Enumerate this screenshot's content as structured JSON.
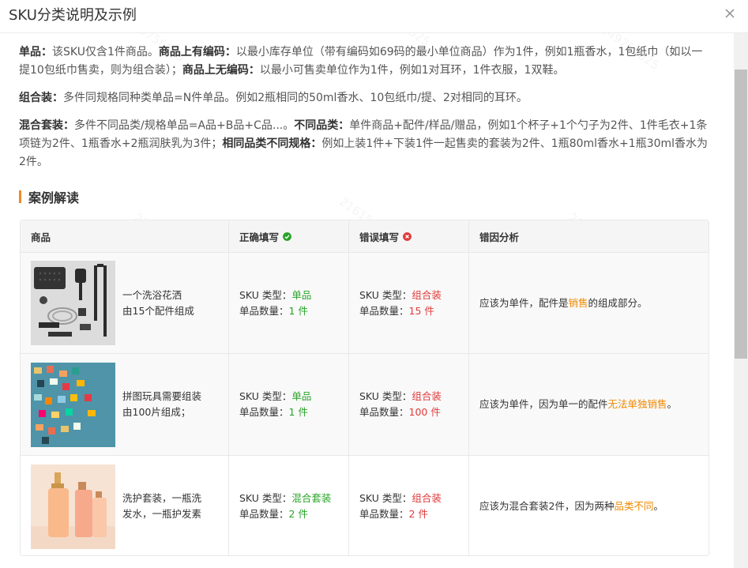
{
  "dialog": {
    "title": "SKU分类说明及示例",
    "close_icon": "close-icon"
  },
  "definitions": {
    "single_label": "单品：",
    "single_text": "该SKU仅含1件商品。",
    "with_code_label": "商品上有编码：",
    "with_code_text": "以最小库存单位（带有编码如69码的最小单位商品）作为1件，例如1瓶香水，1包纸巾（如以一提10包纸巾售卖，则为组合装）；",
    "no_code_label": "商品上无编码：",
    "no_code_text": "以最小可售卖单位作为1件，例如1对耳环，1件衣服，1双鞋。",
    "combo_label": "组合装：",
    "combo_text": "多件同规格同种类单品=N件单品。例如2瓶相同的50ml香水、10包纸巾/提、2对相同的耳环。",
    "mixed_label": "混合套装：",
    "mixed_text": "多件不同品类/规格单品=A品+B品+C品...。",
    "diff_cat_label": "不同品类：",
    "diff_cat_text": "单件商品+配件/样品/赠品，例如1个杯子+1个勺子为2件、1件毛衣+1条项链为2件、1瓶香水+2瓶润肤乳为3件；",
    "same_cat_label": "相同品类不同规格：",
    "same_cat_text": "例如上装1件+下装1件一起售卖的套装为2件、1瓶80ml香水+1瓶30ml香水为2件。"
  },
  "section_title": "案例解读",
  "table": {
    "headers": [
      "商品",
      "正确填写",
      "错误填写",
      "错因分析"
    ],
    "type_label": "SKU 类型：",
    "count_label": "单品数量：",
    "rows": [
      {
        "product_line1": "一个洗浴花洒",
        "product_line2": "由15个配件组成",
        "correct_type": "单品",
        "correct_count": "1 件",
        "wrong_type": "组合装",
        "wrong_count": "15 件",
        "reason_pre": "应该为单件，配件是",
        "reason_hl": "销售",
        "reason_post": "的组成部分。"
      },
      {
        "product_line1": "拼图玩具需要组装",
        "product_line2": "由100片组成；",
        "correct_type": "单品",
        "correct_count": "1 件",
        "wrong_type": "组合装",
        "wrong_count": "100 件",
        "reason_pre": "应该为单件，因为单一的配件",
        "reason_hl": "无法单独销售",
        "reason_post": "。"
      },
      {
        "product_line1": "洗护套装，一瓶洗",
        "product_line2": "发水，一瓶护发素",
        "correct_type": "混合套装",
        "correct_count": "2 件",
        "wrong_type": "组合装",
        "wrong_count": "2 件",
        "reason_pre": "应该为混合套装2件，因为两种",
        "reason_hl": "品类不同",
        "reason_post": "。"
      }
    ]
  },
  "watermark": "2161549756825",
  "colors": {
    "accent": "#f08a24",
    "correct": "#29a329",
    "wrong": "#e03b3b",
    "highlight": "#f08a00"
  }
}
